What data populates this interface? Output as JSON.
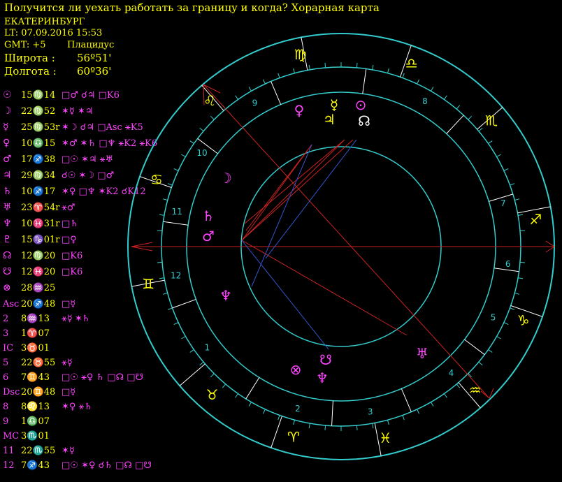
{
  "header": {
    "title": "Получится ли уехать работать за границу и когда? Хорарная карта",
    "city": "ЕКАТЕРИНБУРГ",
    "lt": "LT: 07.09.2016  15:53",
    "gmt": "GMT: +5",
    "system": "Плацидус",
    "lat_label": "Широта :",
    "lat_value": "56º51'",
    "lon_label": "Долгота :",
    "lon_value": "60º36'"
  },
  "planets": [
    {
      "glyph": "☉",
      "pos": "15♍14",
      "aspects": "□♂ ☌♃ □K6"
    },
    {
      "glyph": "☽",
      "pos": "22♍52",
      "aspects": "✶☿ ✶♃"
    },
    {
      "glyph": "☿",
      "pos": "25♍53r",
      "aspects": "✶☽ ☌♃ □Asc ⚹K5"
    },
    {
      "glyph": "♀",
      "pos": "10♎15",
      "aspects": "✶♂ ✶♄ □♆ ⚹K2 ⚹K6"
    },
    {
      "glyph": "♂",
      "pos": "17♐38",
      "aspects": "□☉ ✶♃ ⚹♅"
    },
    {
      "glyph": "♃",
      "pos": "29♍34",
      "aspects": "☌☉ ✶☽ □♂"
    },
    {
      "glyph": "♄",
      "pos": "10♐17",
      "aspects": "✶♀ □♆ ✶K2 ☌K12"
    },
    {
      "glyph": "♅",
      "pos": "23♈54r",
      "aspects": "⚹♂"
    },
    {
      "glyph": "♆",
      "pos": "10♓31r",
      "aspects": "□♄"
    },
    {
      "glyph": "♇",
      "pos": "15♑01r",
      "aspects": "□♀"
    },
    {
      "glyph": "☊",
      "pos": "12♍20",
      "aspects": "□K6"
    },
    {
      "glyph": "☋",
      "pos": "12♓20",
      "aspects": "□K6"
    },
    {
      "glyph": "⊗",
      "pos": "28♒25",
      "aspects": ""
    }
  ],
  "houses": [
    {
      "label": "Asc",
      "pos": "20♐48",
      "aspects": "□☿"
    },
    {
      "label": "2",
      "pos": "8♒13",
      "aspects": "⚹☿ ✶♄"
    },
    {
      "label": "3",
      "pos": "1♈07",
      "aspects": ""
    },
    {
      "label": "IC",
      "pos": "3♉01",
      "aspects": ""
    },
    {
      "label": "5",
      "pos": "22♉55",
      "aspects": "⚹☿"
    },
    {
      "label": "6",
      "pos": "7♊43",
      "aspects": "□☉ ⚹♀ ♄ □☊ □☋"
    },
    {
      "label": "Dsc",
      "pos": "20♊48",
      "aspects": "□☿"
    },
    {
      "label": "8",
      "pos": "8♌13",
      "aspects": "✶♀ ⚹♄"
    },
    {
      "label": "9",
      "pos": "1♎07",
      "aspects": ""
    },
    {
      "label": "MC",
      "pos": "3♏01",
      "aspects": ""
    },
    {
      "label": "11",
      "pos": "22♏55",
      "aspects": "✶☿"
    },
    {
      "label": "12",
      "pos": "7♐43",
      "aspects": "□☉ ✶♀ ☌♄ □☊ □☋"
    }
  ],
  "wheel": {
    "signs": [
      "♍",
      "♌",
      "♋",
      "♊",
      "♉",
      "♈",
      "♓",
      "♒",
      "♑",
      "♐",
      "♏",
      "♎"
    ],
    "cusp_numbers": [
      "8",
      "7",
      "6",
      "5",
      "4",
      "3",
      "2",
      "1",
      "12",
      "11",
      "10",
      "9"
    ],
    "planet_glyphs": [
      {
        "g": "♀",
        "c": "#ff44ff"
      },
      {
        "g": "☿",
        "c": "#ffff00"
      },
      {
        "g": "⊙",
        "c": "#ff44ff"
      },
      {
        "g": "♃",
        "c": "#ffff00"
      },
      {
        "g": "☊",
        "c": "#ffffff"
      },
      {
        "g": "☽",
        "c": "#ff44ff"
      },
      {
        "g": "♄",
        "c": "#ff44ff"
      },
      {
        "g": "♂",
        "c": "#ff44ff"
      },
      {
        "g": "♆",
        "c": "#ff44ff"
      },
      {
        "g": "⊗",
        "c": "#ff44ff"
      },
      {
        "g": "☋",
        "c": "#ff44ff"
      },
      {
        "g": "♆",
        "c": "#ff44ff"
      },
      {
        "g": "♅",
        "c": "#ff44ff"
      }
    ]
  },
  "colors": {
    "ring": "#33cccc",
    "sign": "#ffff00",
    "axis": "#cc2222",
    "aspect_blue": "#3355cc",
    "aspect_red": "#cc2222",
    "planet": "#ff44ff",
    "text": "#ffff00"
  }
}
